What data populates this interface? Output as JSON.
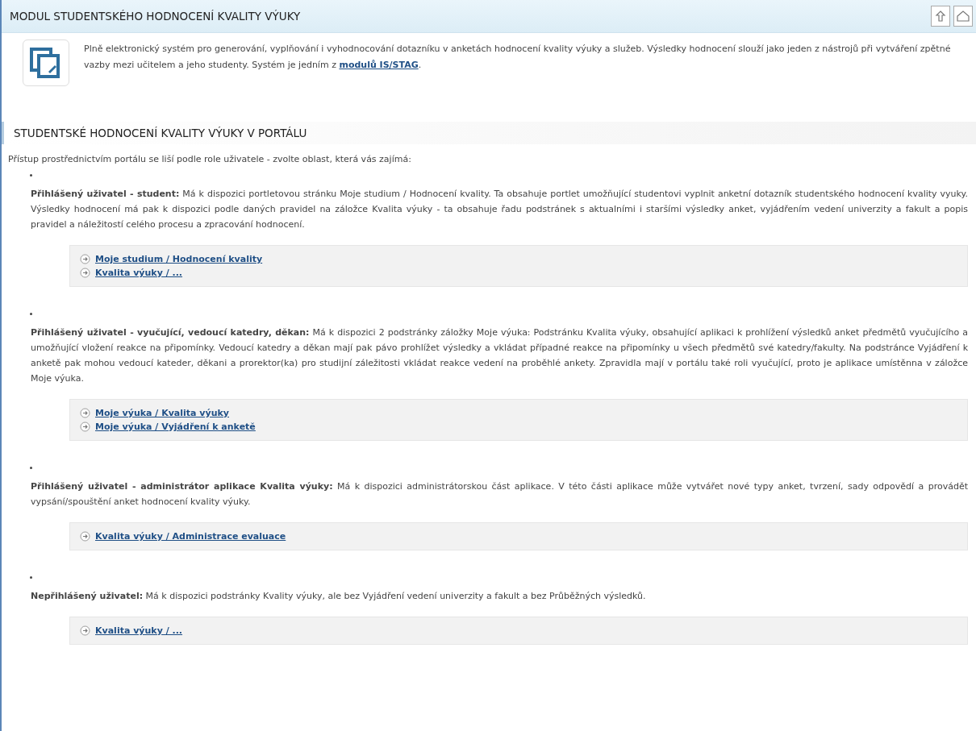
{
  "title": "MODUL STUDENTSKÉHO HODNOCENÍ KVALITY VÝUKY",
  "intro": {
    "text": "Plně elektronický systém pro generování, vyplňování i vyhodnocování dotazníku v anketách hodnocení kvality výuky a služeb. Výsledky hodnocení slouží jako jeden z nástrojů při vytváření zpětné vazby mezi učitelem a jeho studenty. Systém je jedním z",
    "link": "modulů IS/STAG",
    "end": "."
  },
  "section": {
    "heading": "STUDENTSKÉ HODNOCENÍ KVALITY VÝUKY V PORTÁLU",
    "lead": "Přístup prostřednictvím portálu se liší podle role uživatele - zvolte oblast, která vás zajímá:"
  },
  "roles": [
    {
      "text": "**Přihlášený uživatel - student:** Má k dispozici portletovou stránku Moje studium / Hodnocení kvality. Ta obsahuje portlet umožňující studentovi vyplnit anketní dotazník studentského hodnocení kvality vyuky. Výsledky hodnocení má pak k dispozici podle daných pravidel na záložce Kvalita výuky - ta obsahuje řadu podstránek s aktualními i staršími výsledky anket, vyjádřením vedení univerzity a fakult a popis pravidel a náležitostí celého procesu a zpracování hodnocení.",
      "links": [
        "Moje studium / Hodnocení kvality",
        "Kvalita výuky / ..."
      ]
    },
    {
      "text": "**Přihlášený uživatel - vyučující, vedoucí katedry, děkan:** Má k dispozici 2 podstránky záložky Moje výuka: Podstránku Kvalita výuky, obsahující aplikaci k prohlížení výsledků anket předmětů vyučujícího a umožňující vložení reakce na připomínky. Vedoucí katedry a děkan mají pak pávo prohlížet výsledky a vkládat případné reakce na připomínky u všech předmětů své katedry/fakulty. Na podstránce Vyjádření k anketě pak mohou vedoucí kateder, děkani a prorektor(ka) pro studijní záležitosti vkládat reakce vedení na proběhlé ankety. Zpravidla mají v portálu také roli vyučující, proto je aplikace umístěnna v záložce Moje výuka.",
      "links": [
        "Moje výuka / Kvalita výuky",
        "Moje výuka / Vyjádření k anketě"
      ]
    },
    {
      "text": "**Přihlášený uživatel - administrátor aplikace Kvalita výuky:** Má k dispozici administrátorskou část aplikace. V této části aplikace může vytvářet nové typy anket, tvrzení, sady odpovědí a provádět vypsání/spouštění anket hodnocení kvality výuky.",
      "links": [
        "Kvalita výuky / Administrace evaluace"
      ]
    },
    {
      "text": "**Nepřihlášený uživatel:** Má k dispozici podstránky Kvality výuky, ale bez Vyjádření vedení univerzity a fakult a bez Průběžných výsledků.",
      "links": [
        "Kvalita výuky / ..."
      ]
    }
  ]
}
